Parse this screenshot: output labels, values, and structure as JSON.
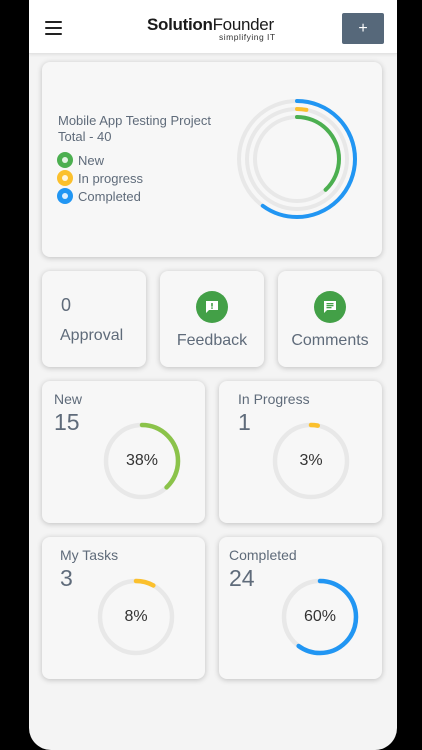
{
  "header": {
    "logo_part1": "Solution",
    "logo_part2": "Founder",
    "logo_tagline": "simplifying IT",
    "add_label": "+"
  },
  "project": {
    "title": "Mobile App Testing Project",
    "total_label": "Total - 40",
    "legend": [
      {
        "label": "New",
        "color": "#4caf50"
      },
      {
        "label": "In progress",
        "color": "#fbc02d"
      },
      {
        "label": "Completed",
        "color": "#2196f3"
      }
    ],
    "rings": [
      {
        "name": "Completed",
        "value": 0.6,
        "color": "#2196f3"
      },
      {
        "name": "In progress",
        "value": 0.03,
        "color": "#fbc02d"
      },
      {
        "name": "New",
        "value": 0.38,
        "color": "#4caf50"
      }
    ]
  },
  "actions": {
    "approval_count": "0",
    "approval_label": "Approval",
    "feedback_label": "Feedback",
    "comments_label": "Comments"
  },
  "stats": [
    {
      "title": "New",
      "count": "15",
      "percent_label": "38%",
      "value": 0.38,
      "color": "#8bc34a"
    },
    {
      "title": "In Progress",
      "count": "1",
      "percent_label": "3%",
      "value": 0.03,
      "color": "#fbc02d"
    },
    {
      "title": "My Tasks",
      "count": "3",
      "percent_label": "8%",
      "value": 0.08,
      "color": "#fbc02d"
    },
    {
      "title": "Completed",
      "count": "24",
      "percent_label": "60%",
      "value": 0.6,
      "color": "#2196f3"
    }
  ],
  "colors": {
    "track": "#e8e8e8",
    "icon_green": "#43a047",
    "button": "#56687a"
  }
}
